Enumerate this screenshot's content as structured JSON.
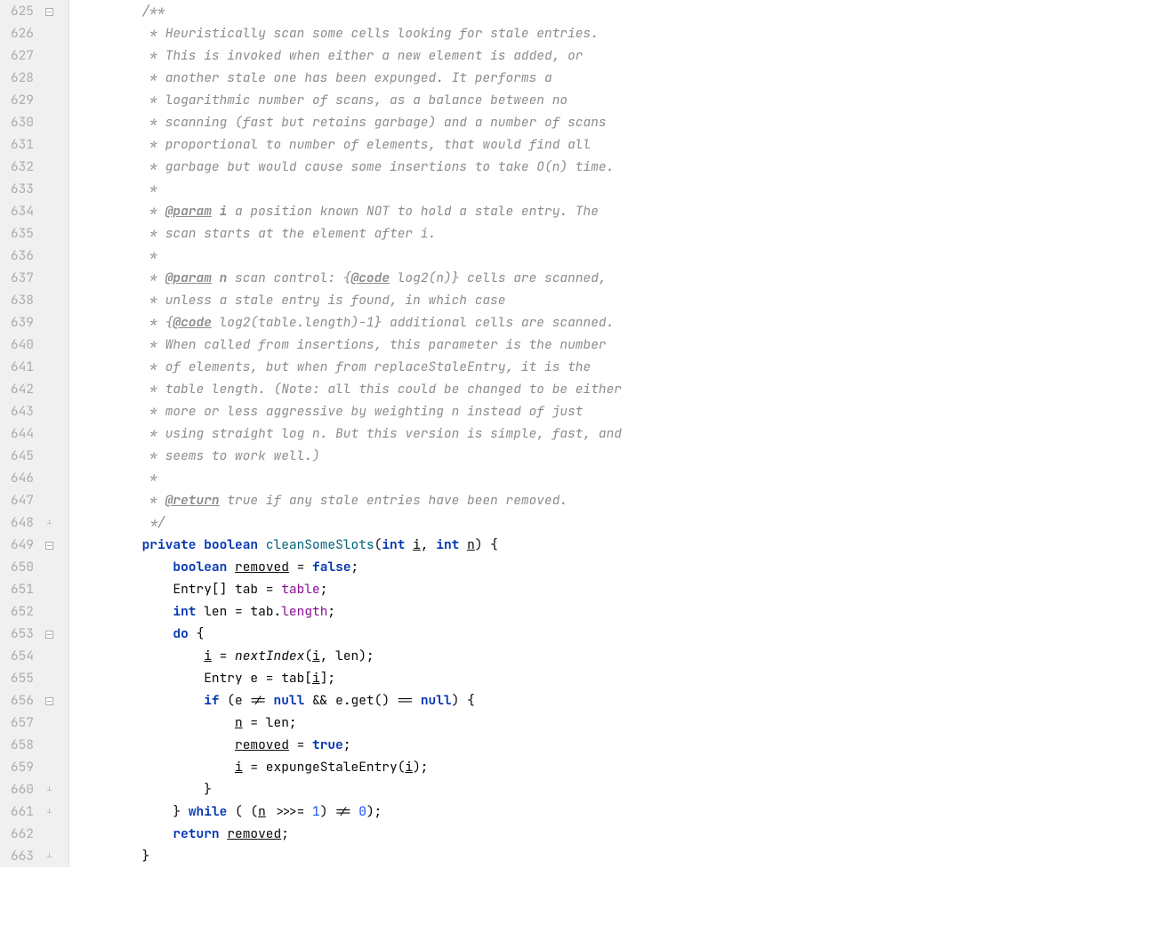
{
  "startLine": 625,
  "endLine": 663,
  "foldMarkers": [
    {
      "line": 625,
      "type": "open"
    },
    {
      "line": 648,
      "type": "close"
    },
    {
      "line": 649,
      "type": "open"
    },
    {
      "line": 653,
      "type": "open"
    },
    {
      "line": 656,
      "type": "open"
    },
    {
      "line": 660,
      "type": "close"
    },
    {
      "line": 661,
      "type": "close"
    },
    {
      "line": 663,
      "type": "close"
    }
  ],
  "lines": {
    "625": [
      {
        "c": "comment",
        "t": "        /**"
      }
    ],
    "626": [
      {
        "c": "comment",
        "t": "         * Heuristically scan some cells looking for stale entries."
      }
    ],
    "627": [
      {
        "c": "comment",
        "t": "         * This is invoked when either a new element is added, or"
      }
    ],
    "628": [
      {
        "c": "comment",
        "t": "         * another stale one has been expunged. It performs a"
      }
    ],
    "629": [
      {
        "c": "comment",
        "t": "         * logarithmic number of scans, as a balance between no"
      }
    ],
    "630": [
      {
        "c": "comment",
        "t": "         * scanning (fast but retains garbage) and a number of scans"
      }
    ],
    "631": [
      {
        "c": "comment",
        "t": "         * proportional to number of elements, that would find all"
      }
    ],
    "632": [
      {
        "c": "comment",
        "t": "         * garbage but would cause some insertions to take O(n) time."
      }
    ],
    "633": [
      {
        "c": "comment",
        "t": "         *"
      }
    ],
    "634": [
      {
        "c": "comment",
        "t": "         * "
      },
      {
        "c": "doctag",
        "t": "@param"
      },
      {
        "c": "comment",
        "t": " "
      },
      {
        "c": "comment bold",
        "t": "i"
      },
      {
        "c": "comment",
        "t": " a position known NOT to hold a stale entry. The"
      }
    ],
    "635": [
      {
        "c": "comment",
        "t": "         * scan starts at the element after i."
      }
    ],
    "636": [
      {
        "c": "comment",
        "t": "         *"
      }
    ],
    "637": [
      {
        "c": "comment",
        "t": "         * "
      },
      {
        "c": "doctag",
        "t": "@param"
      },
      {
        "c": "comment",
        "t": " "
      },
      {
        "c": "comment bold",
        "t": "n"
      },
      {
        "c": "comment",
        "t": " scan control: {"
      },
      {
        "c": "doctag",
        "t": "@code"
      },
      {
        "c": "comment",
        "t": " log2(n)} cells are scanned,"
      }
    ],
    "638": [
      {
        "c": "comment",
        "t": "         * unless a stale entry is found, in which case"
      }
    ],
    "639": [
      {
        "c": "comment",
        "t": "         * {"
      },
      {
        "c": "doctag",
        "t": "@code"
      },
      {
        "c": "comment",
        "t": " log2(table.length)-1} additional cells are scanned."
      }
    ],
    "640": [
      {
        "c": "comment",
        "t": "         * When called from insertions, this parameter is the number"
      }
    ],
    "641": [
      {
        "c": "comment",
        "t": "         * of elements, but when from replaceStaleEntry, it is the"
      }
    ],
    "642": [
      {
        "c": "comment",
        "t": "         * table length. (Note: all this could be changed to be either"
      }
    ],
    "643": [
      {
        "c": "comment",
        "t": "         * more or less aggressive by weighting n instead of just"
      }
    ],
    "644": [
      {
        "c": "comment",
        "t": "         * using straight log n. But this version is simple, fast, and"
      }
    ],
    "645": [
      {
        "c": "comment",
        "t": "         * seems to work well.)"
      }
    ],
    "646": [
      {
        "c": "comment",
        "t": "         *"
      }
    ],
    "647": [
      {
        "c": "comment",
        "t": "         * "
      },
      {
        "c": "doctag",
        "t": "@return"
      },
      {
        "c": "comment",
        "t": " true if any stale entries have been removed."
      }
    ],
    "648": [
      {
        "c": "comment",
        "t": "         */"
      }
    ],
    "649": [
      {
        "c": "plain",
        "t": "        "
      },
      {
        "c": "keyword",
        "t": "private boolean"
      },
      {
        "c": "plain",
        "t": " "
      },
      {
        "c": "method",
        "t": "cleanSomeSlots"
      },
      {
        "c": "plain",
        "t": "("
      },
      {
        "c": "keyword",
        "t": "int"
      },
      {
        "c": "plain",
        "t": " "
      },
      {
        "c": "param",
        "t": "i"
      },
      {
        "c": "plain",
        "t": ", "
      },
      {
        "c": "keyword",
        "t": "int"
      },
      {
        "c": "plain",
        "t": " "
      },
      {
        "c": "param",
        "t": "n"
      },
      {
        "c": "plain",
        "t": ") {"
      }
    ],
    "650": [
      {
        "c": "plain",
        "t": "            "
      },
      {
        "c": "keyword",
        "t": "boolean"
      },
      {
        "c": "plain",
        "t": " "
      },
      {
        "c": "param",
        "t": "removed"
      },
      {
        "c": "plain",
        "t": " = "
      },
      {
        "c": "keyword",
        "t": "false"
      },
      {
        "c": "plain",
        "t": ";"
      }
    ],
    "651": [
      {
        "c": "plain",
        "t": "            Entry[] tab = "
      },
      {
        "c": "field",
        "t": "table"
      },
      {
        "c": "plain",
        "t": ";"
      }
    ],
    "652": [
      {
        "c": "plain",
        "t": "            "
      },
      {
        "c": "keyword",
        "t": "int"
      },
      {
        "c": "plain",
        "t": " len = tab."
      },
      {
        "c": "field",
        "t": "length"
      },
      {
        "c": "plain",
        "t": ";"
      }
    ],
    "653": [
      {
        "c": "plain",
        "t": "            "
      },
      {
        "c": "keyword",
        "t": "do"
      },
      {
        "c": "plain",
        "t": " {"
      }
    ],
    "654": [
      {
        "c": "plain",
        "t": "                "
      },
      {
        "c": "param",
        "t": "i"
      },
      {
        "c": "plain",
        "t": " = "
      },
      {
        "c": "static-method",
        "t": "nextIndex"
      },
      {
        "c": "lb",
        "t": "("
      },
      {
        "c": "param",
        "t": "i"
      },
      {
        "c": "plain",
        "t": ", len);"
      }
    ],
    "655": [
      {
        "c": "plain",
        "t": "                Entry e = tab["
      },
      {
        "c": "param",
        "t": "i"
      },
      {
        "c": "plain",
        "t": "];"
      }
    ],
    "656": [
      {
        "c": "plain",
        "t": "                "
      },
      {
        "c": "keyword",
        "t": "if"
      },
      {
        "c": "plain",
        "t": " (e != "
      },
      {
        "c": "keyword",
        "t": "null"
      },
      {
        "c": "plain",
        "t": " && e.get() == "
      },
      {
        "c": "keyword",
        "t": "null"
      },
      {
        "c": "plain",
        "t": ") {"
      }
    ],
    "657": [
      {
        "c": "plain",
        "t": "                    "
      },
      {
        "c": "param",
        "t": "n"
      },
      {
        "c": "plain",
        "t": " = len;"
      }
    ],
    "658": [
      {
        "c": "plain",
        "t": "                    "
      },
      {
        "c": "param",
        "t": "removed"
      },
      {
        "c": "plain",
        "t": " = "
      },
      {
        "c": "keyword",
        "t": "true"
      },
      {
        "c": "plain",
        "t": ";"
      }
    ],
    "659": [
      {
        "c": "plain",
        "t": "                    "
      },
      {
        "c": "param",
        "t": "i"
      },
      {
        "c": "plain",
        "t": " = expungeStaleEntry("
      },
      {
        "c": "param",
        "t": "i"
      },
      {
        "c": "plain",
        "t": ");"
      }
    ],
    "660": [
      {
        "c": "plain",
        "t": "                }"
      }
    ],
    "661": [
      {
        "c": "plain",
        "t": "            } "
      },
      {
        "c": "keyword",
        "t": "while"
      },
      {
        "c": "plain",
        "t": " ( ("
      },
      {
        "c": "param",
        "t": "n"
      },
      {
        "c": "plain",
        "t": " >>>= "
      },
      {
        "c": "number",
        "t": "1"
      },
      {
        "c": "plain",
        "t": ") != "
      },
      {
        "c": "number",
        "t": "0"
      },
      {
        "c": "plain",
        "t": ");"
      }
    ],
    "662": [
      {
        "c": "plain",
        "t": "            "
      },
      {
        "c": "keyword",
        "t": "return"
      },
      {
        "c": "plain",
        "t": " "
      },
      {
        "c": "param",
        "t": "removed"
      },
      {
        "c": "plain",
        "t": ";"
      }
    ],
    "663": [
      {
        "c": "plain",
        "t": "        }"
      }
    ]
  }
}
